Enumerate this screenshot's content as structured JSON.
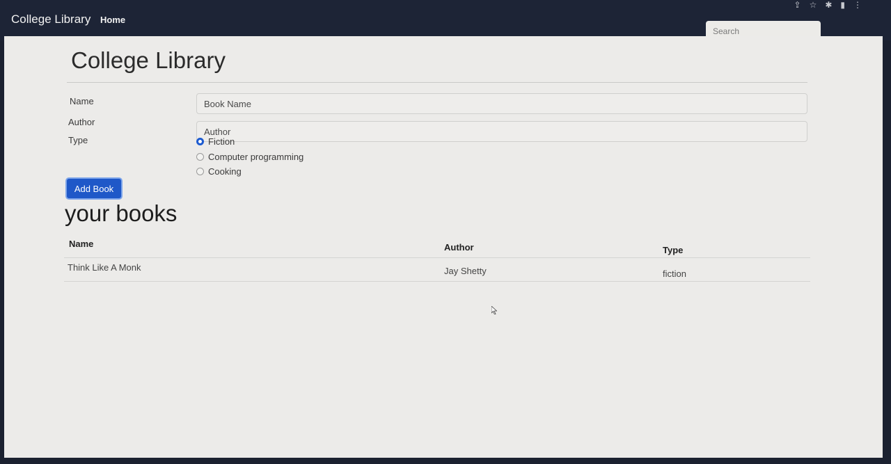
{
  "navbar": {
    "brand": "College Library",
    "home": "Home",
    "search_placeholder": "Search"
  },
  "page": {
    "title": "College Library"
  },
  "form": {
    "name_label": "Name",
    "name_placeholder": "Book Name",
    "author_label": "Author",
    "author_placeholder": "Author",
    "type_label": "Type",
    "types": [
      {
        "label": "Fiction",
        "checked": true
      },
      {
        "label": "Computer programming",
        "checked": false
      },
      {
        "label": "Cooking",
        "checked": false
      }
    ],
    "submit_label": "Add Book"
  },
  "books": {
    "heading": "your books",
    "columns": [
      "Name",
      "Author",
      "Type"
    ],
    "rows": [
      {
        "name": "Think Like A Monk",
        "author": "Jay Shetty",
        "type": "fiction"
      }
    ]
  },
  "colors": {
    "navbar_bg": "#1d2436",
    "primary_button": "#1f58c8",
    "content_bg": "#ecebe9"
  }
}
